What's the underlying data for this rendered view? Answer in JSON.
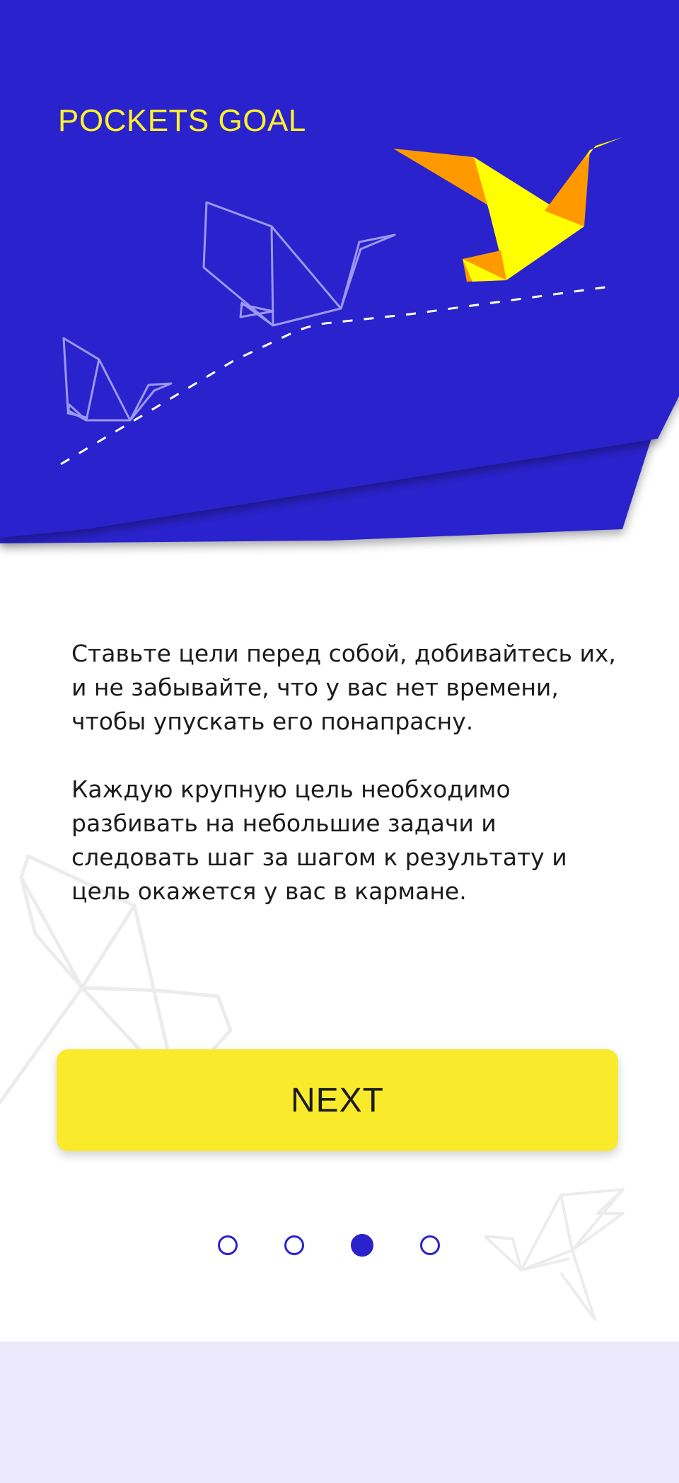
{
  "app": {
    "title": "POCKETS GOAL"
  },
  "colors": {
    "hero_blue": "#2a22cc",
    "accent_yellow": "#fff22a",
    "button_yellow": "#f9eb2c",
    "crane_orange": "#ff9900",
    "footer_lavender": "#ece9fd"
  },
  "description": {
    "paragraph_1": "Ставьте цели перед собой, добивайтесь их, и не забывайте, что у вас нет времени, чтобы упускать его понапрасну.",
    "paragraph_2": "Каждую крупную цель необходимо разбивать на небольшие задачи и следовать шаг за шагом к результату и цель окажется у вас в кармане."
  },
  "next_button": {
    "label": "NEXT"
  },
  "pagination": {
    "total": 4,
    "current": 3
  },
  "icons": {
    "hero_cranes": [
      "small-crane-outline-icon",
      "medium-crane-outline-icon",
      "large-yellow-crane-icon"
    ],
    "background_cranes": [
      "bg-crane-left-icon",
      "bg-crane-right-icon"
    ]
  }
}
